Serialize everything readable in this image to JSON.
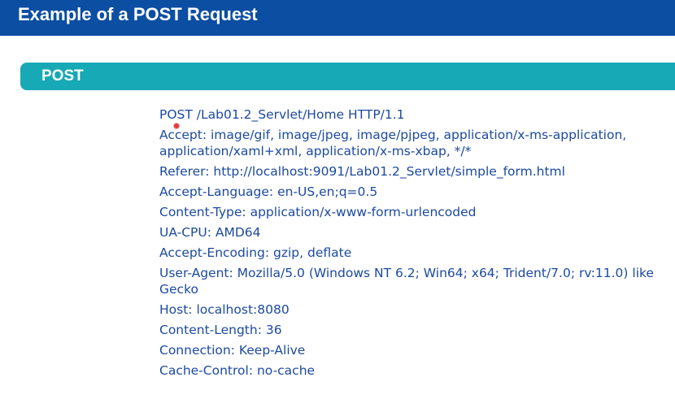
{
  "header": {
    "title": "Example of a POST Request"
  },
  "section": {
    "label": "POST"
  },
  "request": {
    "lines": [
      "POST /Lab01.2_Servlet/Home HTTP/1.1",
      "Accept: image/gif, image/jpeg, image/pjpeg, application/x-ms-application, application/xaml+xml, application/x-ms-xbap, */*",
      "Referer: http://localhost:9091/Lab01.2_Servlet/simple_form.html",
      "Accept-Language: en-US,en;q=0.5",
      "Content-Type: application/x-www-form-urlencoded",
      "UA-CPU: AMD64",
      "Accept-Encoding: gzip, deflate",
      "User-Agent: Mozilla/5.0 (Windows NT 6.2; Win64; x64; Trident/7.0; rv:11.0) like Gecko",
      "Host: localhost:8080",
      "Content-Length: 36",
      "Connection: Keep-Alive",
      "Cache-Control: no-cache"
    ]
  },
  "colors": {
    "title_bar": "#0b4ea2",
    "section_banner": "#17a9b5",
    "request_text": "#1c4aa0",
    "pointer": "#e23b3b"
  },
  "icons": {
    "pointer": "laser-pointer-dot"
  }
}
